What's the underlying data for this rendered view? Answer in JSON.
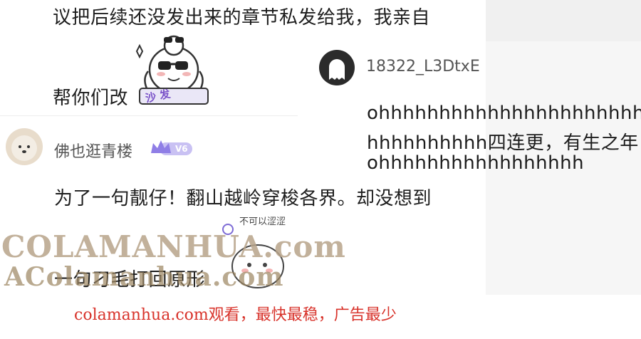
{
  "comment_top": {
    "line1": "议把后续还没发出来的章节私发给我，我亲自",
    "line2": "帮你们改",
    "sticker_label": "沙 发"
  },
  "reply_right": {
    "username": "18322_L3DtxE",
    "line1": "ohhhhhhhhhhhhhhhhhhhhhhh",
    "line2": "hhhhhhhhhh四连更，有生之年",
    "line3": "ohhhhhhhhhhhhhhhhh"
  },
  "comment_bottom": {
    "username": "佛也逛青楼",
    "level_badge": "V6",
    "line1": "为了一句靓仔！翻山越岭穿梭各界。却没想到",
    "sticker_label": "不可以涩涩",
    "line2": "一句刁毛打回原形"
  },
  "watermarks": {
    "site": "COLAMANHUA.com",
    "site2": "AColamanhua.com"
  },
  "ad_text": "colamanhua.com观看，最快最稳，广告最少",
  "colors": {
    "ad_red": "#d8332b",
    "badge_purple": "#8f7ee6"
  }
}
